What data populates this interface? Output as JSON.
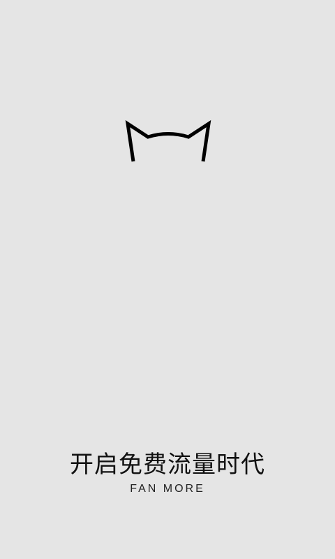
{
  "splash": {
    "logo_icon": "cat-ears-logo-icon",
    "tagline_cn": "开启免费流量时代",
    "tagline_en": "FAN MORE"
  },
  "colors": {
    "background": "#e5e5e5",
    "logo": "#000000",
    "text": "#111111"
  }
}
